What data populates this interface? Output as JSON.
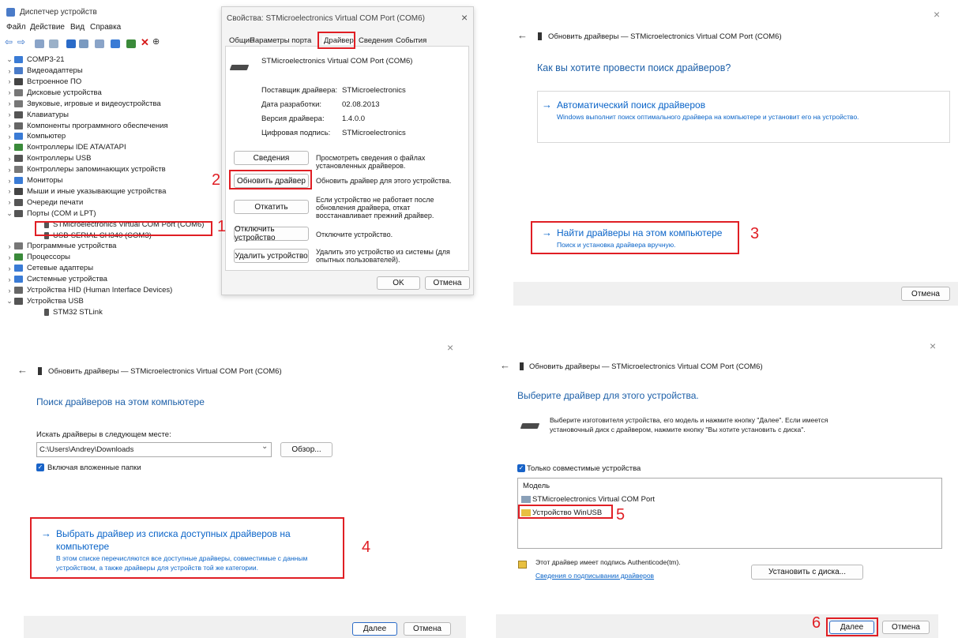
{
  "device_manager": {
    "title": "Диспетчер устройств",
    "menu": [
      "Файл",
      "Действие",
      "Вид",
      "Справка"
    ],
    "root": "COMP3-21",
    "tree": [
      {
        "label": "Видеоадаптеры",
        "chev": "›",
        "color": "#4a7bc8"
      },
      {
        "label": "Встроенное ПО",
        "chev": "›",
        "color": "#444444"
      },
      {
        "label": "Дисковые устройства",
        "chev": "›",
        "color": "#777777"
      },
      {
        "label": "Звуковые, игровые и видеоустройства",
        "chev": "›",
        "color": "#777777"
      },
      {
        "label": "Клавиатуры",
        "chev": "›",
        "color": "#555555"
      },
      {
        "label": "Компоненты программного обеспечения",
        "chev": "›",
        "color": "#666666"
      },
      {
        "label": "Компьютер",
        "chev": "›",
        "color": "#3a7bd5"
      },
      {
        "label": "Контроллеры IDE ATA/ATAPI",
        "chev": "›",
        "color": "#3a8a3a"
      },
      {
        "label": "Контроллеры USB",
        "chev": "›",
        "color": "#555555"
      },
      {
        "label": "Контроллеры запоминающих устройств",
        "chev": "›",
        "color": "#777777"
      },
      {
        "label": "Мониторы",
        "chev": "›",
        "color": "#3a7bd5"
      },
      {
        "label": "Мыши и иные указывающие устройства",
        "chev": "›",
        "color": "#444444"
      },
      {
        "label": "Очереди печати",
        "chev": "›",
        "color": "#555555"
      },
      {
        "label": "Порты (COM и LPT)",
        "chev": "⌄",
        "color": "#555555"
      },
      {
        "label": "STMicroelectronics Virtual COM Port (COM6)",
        "chev": "",
        "color": "#555555",
        "indent": 1
      },
      {
        "label": "USB-SERIAL CH340 (COM3)",
        "chev": "",
        "color": "#555555",
        "indent": 1
      },
      {
        "label": "Программные устройства",
        "chev": "›",
        "color": "#777777"
      },
      {
        "label": "Процессоры",
        "chev": "›",
        "color": "#3a8a3a"
      },
      {
        "label": "Сетевые адаптеры",
        "chev": "›",
        "color": "#3a7bd5"
      },
      {
        "label": "Системные устройства",
        "chev": "›",
        "color": "#3a7bd5"
      },
      {
        "label": "Устройства HID (Human Interface Devices)",
        "chev": "›",
        "color": "#666666"
      },
      {
        "label": "Устройства USB",
        "chev": "⌄",
        "color": "#555555"
      },
      {
        "label": "STM32 STLink",
        "chev": "",
        "color": "#555555",
        "indent": 1
      }
    ]
  },
  "properties": {
    "title": "Свойства: STMicroelectronics Virtual COM Port (COM6)",
    "tabs": [
      "Общие",
      "Параметры порта",
      "Драйвер",
      "Сведения",
      "События"
    ],
    "device_name": "STMicroelectronics Virtual COM Port (COM6)",
    "fields": [
      {
        "label": "Поставщик драйвера:",
        "value": "STMicroelectronics"
      },
      {
        "label": "Дата разработки:",
        "value": "02.08.2013"
      },
      {
        "label": "Версия драйвера:",
        "value": "1.4.0.0"
      },
      {
        "label": "Цифровая подпись:",
        "value": "STMicroelectronics"
      }
    ],
    "buttons": [
      {
        "label": "Сведения",
        "desc": "Просмотреть сведения о файлах установленных драйверов."
      },
      {
        "label": "Обновить драйвер",
        "desc": "Обновить драйвер для этого устройства."
      },
      {
        "label": "Откатить",
        "desc": "Если устройство не работает после обновления драйвера, откат восстанавливает прежний драйвер."
      },
      {
        "label": "Отключить устройство",
        "desc": "Отключите устройство."
      },
      {
        "label": "Удалить устройство",
        "desc": "Удалить это устройство из системы (для опытных пользователей)."
      }
    ],
    "ok": "OK",
    "cancel": "Отмена"
  },
  "wizard_header": "Обновить драйверы — STMicroelectronics Virtual COM Port (COM6)",
  "panel2": {
    "question": "Как вы хотите провести поиск драйверов?",
    "auto_title": "Автоматический поиск драйверов",
    "auto_desc": "Windows выполнит поиск оптимального драйвера на компьютере и установит его на устройство.",
    "manual_title": "Найти драйверы на этом компьютере",
    "manual_desc": "Поиск и установка драйвера вручную.",
    "cancel": "Отмена"
  },
  "panel3": {
    "heading": "Поиск драйверов на этом компьютере",
    "search_label": "Искать драйверы в следующем месте:",
    "path": "C:\\Users\\Andrey\\Downloads",
    "browse": "Обзор...",
    "include_sub": "Включая вложенные папки",
    "pick_title_1": "Выбрать драйвер из списка доступных драйверов на",
    "pick_title_2": "компьютере",
    "pick_desc_1": "В этом списке перечисляются все доступные драйверы, совместимые с данным",
    "pick_desc_2": "устройством, а также драйверы для устройств той же категории.",
    "next": "Далее",
    "cancel": "Отмена"
  },
  "panel4": {
    "heading": "Выберите драйвер для этого устройства.",
    "desc_1": "Выберите изготовителя устройства, его модель и нажмите кнопку \"Далее\". Если имеется",
    "desc_2": "установочный диск с драйвером, нажмите кнопку \"Вы хотите установить с диска\".",
    "compat": "Только совместимые устройства",
    "model_header": "Модель",
    "models": [
      "STMicroelectronics Virtual COM Port",
      "Устройство WinUSB"
    ],
    "signed": "Этот драйвер имеет подпись Authenticode(tm).",
    "signing_link": "Сведения о подписывании драйверов",
    "install_disk": "Установить с диска...",
    "next": "Далее",
    "cancel": "Отмена"
  },
  "steps": [
    "1",
    "2",
    "3",
    "4",
    "5",
    "6"
  ],
  "icons": {
    "close": "×",
    "back": "←",
    "arrow": "→",
    "check": "✓",
    "chevron": "⌄"
  }
}
